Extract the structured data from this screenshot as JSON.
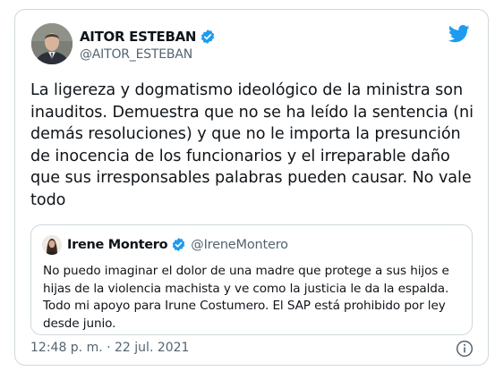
{
  "tweet": {
    "author_name": "AITOR ESTEBAN",
    "author_handle": "@AITOR_ESTEBAN",
    "text": "La ligereza y dogmatismo ideológico de la ministra son inauditos. Demuestra que no se ha leído la sentencia (ni demás resoluciones) y que no le importa la presunción de inocencia de los funcionarios y el irreparable daño que sus irresponsables palabras pueden causar. No vale todo",
    "timestamp": "12:48 p. m. · 22 jul. 2021"
  },
  "quoted_tweet": {
    "author_name": "Irene Montero",
    "author_handle": "@IreneMontero",
    "text": "No puedo imaginar el dolor de una madre que protege a sus hijos e hijas de la violencia machista y ve como la justicia le da la espalda. Todo mi apoyo para Irune Costumero. El SAP está prohibido por ley desde junio."
  },
  "icons": {
    "brand": "twitter-bird-icon",
    "verified": "verified-badge-icon",
    "info": "info-icon"
  },
  "colors": {
    "brand_blue": "#1d9bf0",
    "text_primary": "#0f1419",
    "text_secondary": "#536471",
    "border": "#cfd9de"
  }
}
